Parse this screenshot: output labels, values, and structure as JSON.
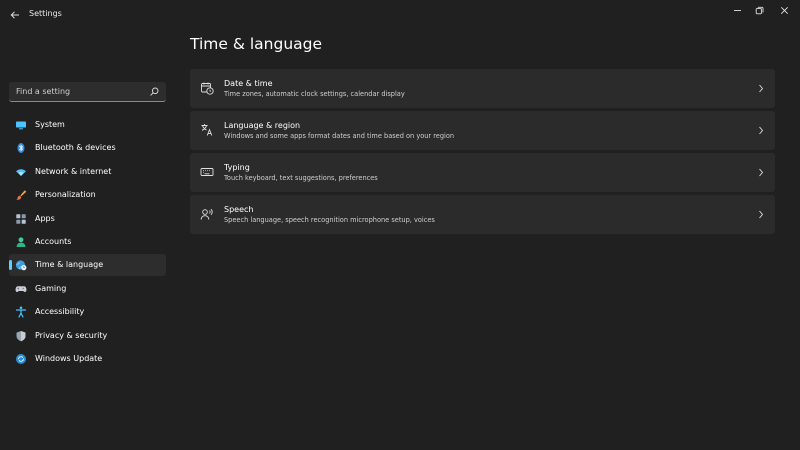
{
  "window": {
    "title": "Settings"
  },
  "search": {
    "placeholder": "Find a setting"
  },
  "sidebar": {
    "items": [
      {
        "label": "System",
        "icon": "monitor-icon"
      },
      {
        "label": "Bluetooth & devices",
        "icon": "bluetooth-icon"
      },
      {
        "label": "Network & internet",
        "icon": "wifi-icon"
      },
      {
        "label": "Personalization",
        "icon": "brush-icon"
      },
      {
        "label": "Apps",
        "icon": "apps-icon"
      },
      {
        "label": "Accounts",
        "icon": "person-icon"
      },
      {
        "label": "Time & language",
        "icon": "globe-clock-icon",
        "selected": true
      },
      {
        "label": "Gaming",
        "icon": "gamepad-icon"
      },
      {
        "label": "Accessibility",
        "icon": "accessibility-icon"
      },
      {
        "label": "Privacy & security",
        "icon": "shield-icon"
      },
      {
        "label": "Windows Update",
        "icon": "update-icon"
      }
    ]
  },
  "main": {
    "title": "Time & language",
    "cards": [
      {
        "title": "Date & time",
        "description": "Time zones, automatic clock settings, calendar display",
        "icon": "calendar-clock-icon"
      },
      {
        "title": "Language & region",
        "description": "Windows and some apps format dates and time based on your region",
        "icon": "language-icon"
      },
      {
        "title": "Typing",
        "description": "Touch keyboard, text suggestions, preferences",
        "icon": "keyboard-icon"
      },
      {
        "title": "Speech",
        "description": "Speech language, speech recognition microphone setup, voices",
        "icon": "speech-icon"
      }
    ]
  },
  "colors": {
    "background": "#202020",
    "card": "#2b2b2b",
    "accent": "#60cdff"
  }
}
